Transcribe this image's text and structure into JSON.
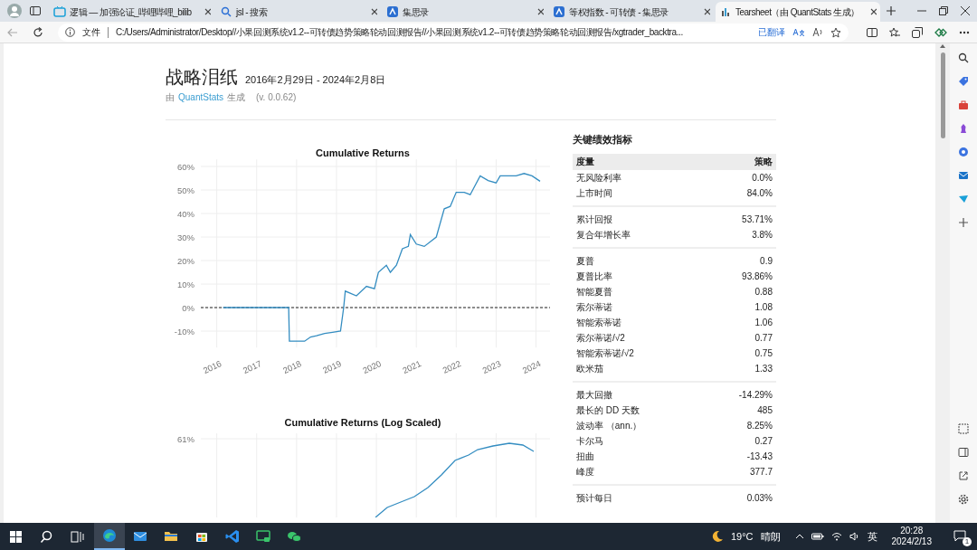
{
  "browser": {
    "tabs": [
      {
        "title": "逻辑 — 加强论证_哔哩哔哩_bilib",
        "kind": "tv",
        "selected": false
      },
      {
        "title": "jsl - 搜索",
        "kind": "search",
        "selected": false
      },
      {
        "title": "集思录",
        "kind": "site",
        "selected": false
      },
      {
        "title": "等权指数 - 可转债 - 集思录",
        "kind": "site",
        "selected": false
      },
      {
        "title": "Tearsheet（由 QuantStats 生成）",
        "kind": "report",
        "selected": true
      }
    ],
    "address": {
      "scheme": "文件",
      "url": "C:/Users/Administrator/Desktop//小果回测系统v1.2--可转债趋势策略轮动回测报告//小果回测系统v1.2--可转债趋势策略轮动回测报告/xgtrader_backtra...",
      "translate": "已翻译"
    }
  },
  "page": {
    "title": "战略泪纸",
    "date_range": "2016年2月29日 - 2024年2月8日",
    "generator": {
      "prefix": "由",
      "link": "QuantStats",
      "suffix": "生成",
      "version": "(v. 0.0.62)"
    },
    "charts": [
      {
        "chart_data": {
          "type": "line",
          "title": "Cumulative Returns",
          "x": [
            2016.16,
            2017.8,
            2017.82,
            2018.2,
            2018.35,
            2018.5,
            2018.7,
            2018.9,
            2019.1,
            2019.18,
            2019.22,
            2019.5,
            2019.75,
            2019.95,
            2020.05,
            2020.25,
            2020.35,
            2020.5,
            2020.65,
            2020.8,
            2020.85,
            2021.0,
            2021.2,
            2021.5,
            2021.7,
            2021.85,
            2022.0,
            2022.2,
            2022.35,
            2022.6,
            2022.8,
            2023.0,
            2023.1,
            2023.5,
            2023.7,
            2023.9,
            2024.1
          ],
          "series": [
            {
              "color": "#348dc1",
              "values": [
                0,
                0,
                -14.3,
                -14.3,
                -12.5,
                -12,
                -11,
                -10.5,
                -10,
                0,
                7,
                5,
                9,
                8,
                15,
                18,
                15,
                18,
                25,
                26,
                31,
                27,
                26,
                30,
                42,
                43,
                49,
                49,
                48,
                56,
                54,
                53,
                56,
                56,
                57,
                56,
                53.7
              ]
            }
          ],
          "xticks": [
            2016,
            2017,
            2018,
            2019,
            2020,
            2021,
            2022,
            2023,
            2024
          ],
          "xlim": [
            2015.6,
            2024.35
          ],
          "grid": true,
          "ref_lines": [
            {
              "axis": "y",
              "value": 0,
              "color": "#222222"
            }
          ],
          "ylim": [
            -17,
            63
          ],
          "yticks": [
            {
              "value": -10,
              "label": "-10%"
            },
            {
              "value": 0,
              "label": "0%"
            },
            {
              "value": 10,
              "label": "10%"
            },
            {
              "value": 20,
              "label": "20%"
            },
            {
              "value": 30,
              "label": "30%"
            },
            {
              "value": 40,
              "label": "40%"
            },
            {
              "value": 50,
              "label": "50%"
            },
            {
              "value": 60,
              "label": "60%"
            }
          ]
        }
      },
      {
        "title": "Cumulative Returns (Log Scaled)",
        "ytick": "61%"
      }
    ],
    "metrics": {
      "title": "关键绩效指标",
      "columns": [
        "度量",
        "策略"
      ],
      "groups": [
        [
          {
            "label": "无风险利率",
            "value": "0.0%"
          },
          {
            "label": "上市时间",
            "value": "84.0%"
          }
        ],
        [
          {
            "label": "累计回报",
            "value": "53.71%"
          },
          {
            "label": "复合年增长率",
            "value": "3.8%"
          }
        ],
        [
          {
            "label": "夏普",
            "value": "0.9"
          },
          {
            "label": "夏普比率",
            "value": "93.86%"
          },
          {
            "label": "智能夏普",
            "value": "0.88"
          },
          {
            "label": "索尔蒂诺",
            "value": "1.08"
          },
          {
            "label": "智能索蒂诺",
            "value": "1.06"
          },
          {
            "label": "索尔蒂诺/√2",
            "value": "0.77"
          },
          {
            "label": "智能索蒂诺/√2",
            "value": "0.75"
          },
          {
            "label": "欧米茄",
            "value": "1.33"
          }
        ],
        [
          {
            "label": "最大回撤",
            "value": "-14.29%"
          },
          {
            "label": "最长的 DD 天数",
            "value": "485"
          },
          {
            "label": "波动率 （ann.）",
            "value": "8.25%"
          },
          {
            "label": "卡尔马",
            "value": "0.27"
          },
          {
            "label": "扭曲",
            "value": "-13.43"
          },
          {
            "label": "峰度",
            "value": "377.7"
          }
        ],
        [
          {
            "label": "预计每日",
            "value": "0.03%"
          }
        ]
      ]
    }
  },
  "taskbar": {
    "apps": [
      {
        "kind": "edge",
        "selected": true
      },
      {
        "kind": "mail",
        "selected": false
      },
      {
        "kind": "folder",
        "selected": false
      },
      {
        "kind": "store",
        "selected": false
      },
      {
        "kind": "code",
        "selected": false
      },
      {
        "kind": "terminal",
        "selected": false
      },
      {
        "kind": "chat",
        "selected": false
      }
    ],
    "weather": {
      "temp": "19°C",
      "condition": "晴朗"
    },
    "ime": "英",
    "time": "20:28",
    "date": "2024/2/13",
    "notifications": "1"
  }
}
